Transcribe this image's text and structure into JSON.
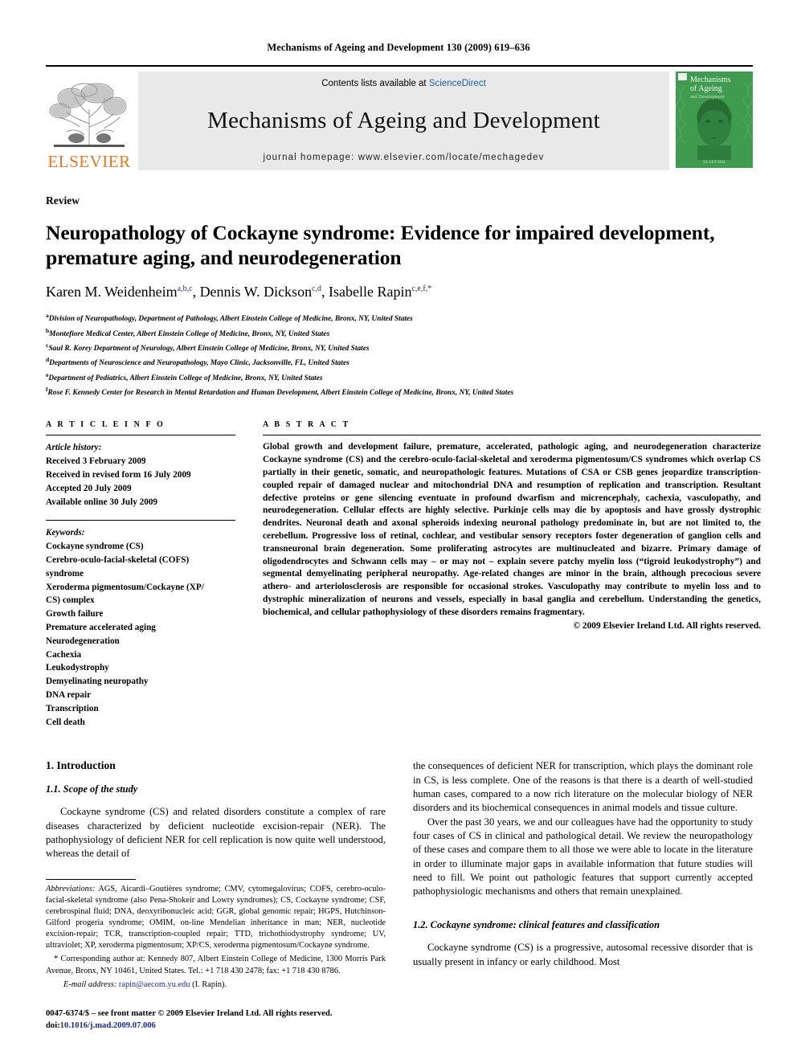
{
  "running_head": "Mechanisms of Ageing and Development 130 (2009) 619–636",
  "banner": {
    "publisher_wordmark": "ELSEVIER",
    "publisher_logo_icon": "elsevier-tree-logo",
    "contents_prefix": "Contents lists available at ",
    "contents_link": "ScienceDirect",
    "journal_name": "Mechanisms of Ageing and Development",
    "homepage": "journal homepage: www.elsevier.com/locate/mechagedev",
    "cover": {
      "title_line1": "Mechanisms",
      "title_line2": "of Ageing",
      "subtitle": "and Development",
      "footer": "ELSEVIER",
      "color": "#3f9b4f"
    }
  },
  "article": {
    "kind": "Review",
    "title": "Neuropathology of Cockayne syndrome: Evidence for impaired development, premature aging, and neurodegeneration",
    "authors": [
      {
        "name": "Karen M. Weidenheim",
        "marks": "a,b,c"
      },
      {
        "name": "Dennis W. Dickson",
        "marks": "c,d"
      },
      {
        "name": "Isabelle Rapin",
        "marks": "c,e,f,*"
      }
    ],
    "affiliations": [
      {
        "mark": "a",
        "text": "Division of Neuropathology, Department of Pathology, Albert Einstein College of Medicine, Bronx, NY, United States"
      },
      {
        "mark": "b",
        "text": "Montefiore Medical Center, Albert Einstein College of Medicine, Bronx, NY, United States"
      },
      {
        "mark": "c",
        "text": "Saul R. Korey Department of Neurology, Albert Einstein College of Medicine, Bronx, NY, United States"
      },
      {
        "mark": "d",
        "text": "Departments of Neuroscience and Neuropathology, Mayo Clinic, Jacksonville, FL, United States"
      },
      {
        "mark": "e",
        "text": "Department of Pediatrics, Albert Einstein College of Medicine, Bronx, NY, United States"
      },
      {
        "mark": "f",
        "text": "Rose F. Kennedy Center for Research in Mental Retardation and Human Development, Albert Einstein College of Medicine, Bronx, NY, United States"
      }
    ]
  },
  "article_info": {
    "heading": "A R T I C L E   I N F O",
    "history_label": "Article history:",
    "history": [
      "Received 3 February 2009",
      "Received in revised form 16 July 2009",
      "Accepted 20 July 2009",
      "Available online 30 July 2009"
    ],
    "keywords_label": "Keywords:",
    "keywords": [
      "Cockayne syndrome (CS)",
      "Cerebro-oculo-facial-skeletal (COFS)",
      "syndrome",
      "Xeroderma pigmentosum/Cockayne (XP/",
      "CS) complex",
      "Growth failure",
      "Premature accelerated aging",
      "Neurodegeneration",
      "Cachexia",
      "Leukodystrophy",
      "Demyelinating neuropathy",
      "DNA repair",
      "Transcription",
      "Cell death"
    ]
  },
  "abstract": {
    "heading": "A B S T R A C T",
    "text": "Global growth and development failure, premature, accelerated, pathologic aging, and neurodegeneration characterize Cockayne syndrome (CS) and the cerebro-oculo-facial-skeletal and xeroderma pigmentosum/CS syndromes which overlap CS partially in their genetic, somatic, and neuropathologic features. Mutations of CSA or CSB genes jeopardize transcription-coupled repair of damaged nuclear and mitochondrial DNA and resumption of replication and transcription. Resultant defective proteins or gene silencing eventuate in profound dwarfism and micrencephaly, cachexia, vasculopathy, and neurodegeneration. Cellular effects are highly selective. Purkinje cells may die by apoptosis and have grossly dystrophic dendrites. Neuronal death and axonal spheroids indexing neuronal pathology predominate in, but are not limited to, the cerebellum. Progressive loss of retinal, cochlear, and vestibular sensory receptors foster degeneration of ganglion cells and transneuronal brain degeneration. Some proliferating astrocytes are multinucleated and bizarre. Primary damage of oligodendrocytes and Schwann cells may – or may not – explain severe patchy myelin loss (“tigroid leukodystrophy”) and segmental demyelinating peripheral neuropathy. Age-related changes are minor in the brain, although precocious severe athero- and arteriolosclerosis are responsible for occasional strokes. Vasculopathy may contribute to myelin loss and to dystrophic mineralization of neurons and vessels, especially in basal ganglia and cerebellum. Understanding the genetics, biochemical, and cellular pathophysiology of these disorders remains fragmentary.",
    "copyright": "© 2009 Elsevier Ireland Ltd. All rights reserved."
  },
  "body": {
    "section_1_heading": "1. Introduction",
    "subsection_1_1_heading": "1.1. Scope of the study",
    "para_1_left": "Cockayne syndrome (CS) and related disorders constitute a complex of rare diseases characterized by deficient nucleotide excision-repair (NER). The pathophysiology of deficient NER for cell replication is now quite well understood, whereas the detail of",
    "para_1_right": "the consequences of deficient NER for transcription, which plays the dominant role in CS, is less complete. One of the reasons is that there is a dearth of well-studied human cases, compared to a now rich literature on the molecular biology of NER disorders and its biochemical consequences in animal models and tissue culture.",
    "para_2_right": "Over the past 30 years, we and our colleagues have had the opportunity to study four cases of CS in clinical and pathological detail. We review the neuropathology of these cases and compare them to all those we were able to locate in the literature in order to illuminate major gaps in available information that future studies will need to fill. We point out pathologic features that support currently accepted pathophysiologic mechanisms and others that remain unexplained.",
    "subsection_1_2_heading": "1.2. Cockayne syndrome: clinical features and classification",
    "para_3_right": "Cockayne syndrome (CS) is a progressive, autosomal recessive disorder that is usually present in infancy or early childhood. Most"
  },
  "footnotes": {
    "abbrev_label": "Abbreviations:",
    "abbrev_text": " AGS, Aicardi–Goutières syndrome; CMV, cytomegalovirus; COFS, cerebro-oculo-facial-skeletal syndrome (also Pena-Shokeir and Lowry syndromes); CS, Cockayne syndrome; CSF, cerebrospinal fluid; DNA, deoxyribonucleic acid; GGR, global genomic repair; HGPS, Hutchinson-Gilford progeria syndrome; OMIM, on-line Mendelian inheritance in man; NER, nucleotide excision-repair; TCR, transcription-coupled repair; TTD, trichothiodystrophy syndrome; UV, ultraviolet; XP, xeroderma pigmentosum; XP/CS, xeroderma pigmentosum/Cockayne syndrome.",
    "corresponding_mark": "*",
    "corresponding_text": " Corresponding author at: Kennedy 807, Albert Einstein College of Medicine, 1300 Morris Park Avenue, Bronx, NY 10461, United States. Tel.: +1 718 430 2478; fax: +1 718 430 8786.",
    "email_label": "E-mail address:",
    "email_value": "rapin@aecom.yu.edu",
    "email_owner": "(I. Rapin)."
  },
  "imprint": {
    "issn_line": "0047-6374/$ – see front matter © 2009 Elsevier Ireland Ltd. All rights reserved.",
    "doi_prefix": "doi:",
    "doi_value": "10.1016/j.mad.2009.07.006"
  }
}
